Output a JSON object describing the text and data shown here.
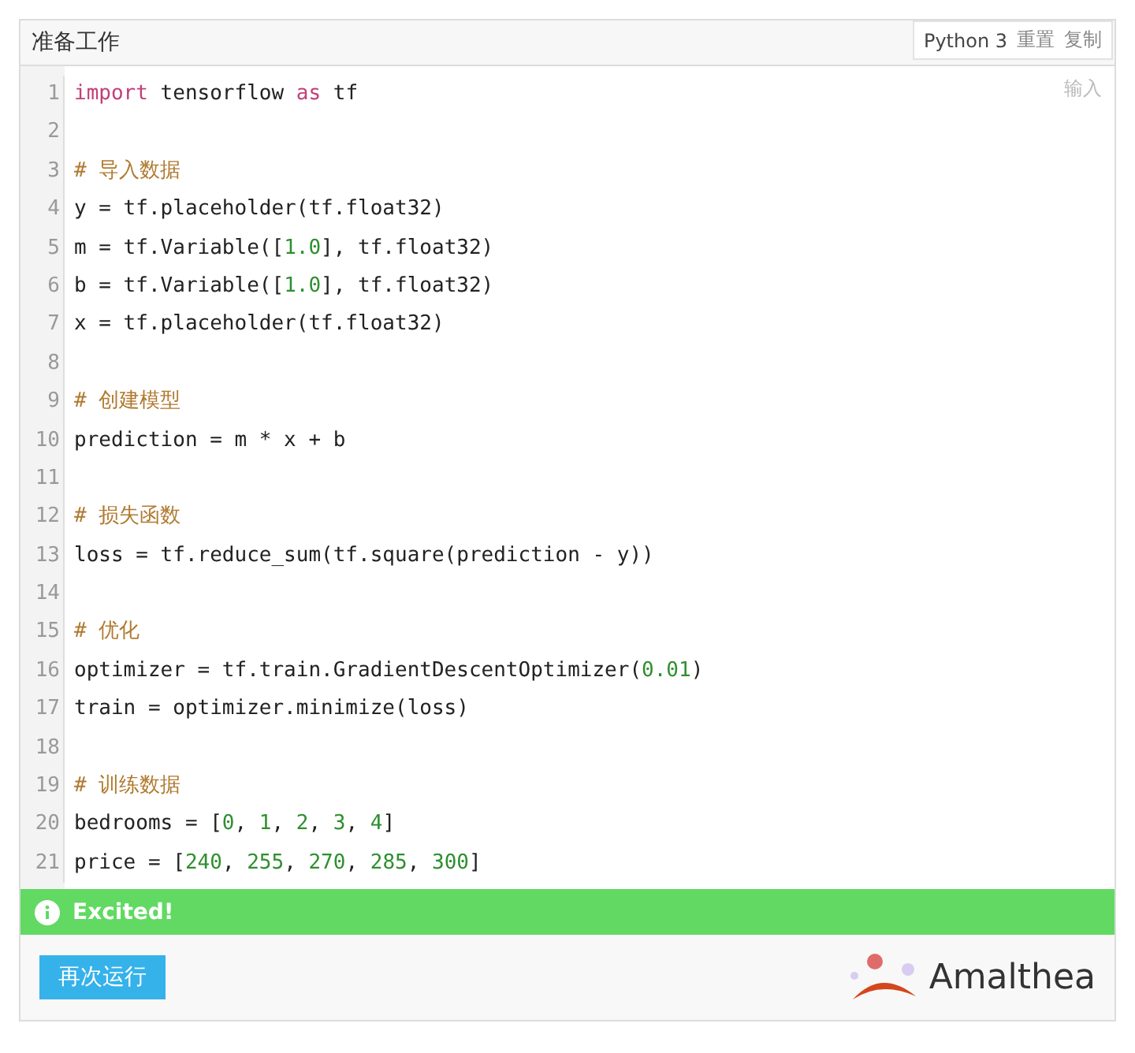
{
  "title": "准备工作",
  "toolbar": {
    "language": "Python 3",
    "actions": [
      "重置",
      "复制"
    ]
  },
  "editor": {
    "placeholder": "输入",
    "lines": [
      {
        "number": "1",
        "tokens": [
          {
            "kind": "keyword",
            "text": "import"
          },
          {
            "kind": "plain",
            "text": " tensorflow "
          },
          {
            "kind": "keyword",
            "text": "as"
          },
          {
            "kind": "plain",
            "text": " tf"
          }
        ]
      },
      {
        "number": "2"
      },
      {
        "number": "3",
        "tokens": [
          {
            "kind": "comment",
            "text": "# 导入数据"
          }
        ]
      },
      {
        "number": "4",
        "tokens": [
          {
            "kind": "plain",
            "text": "y = tf.placeholder(tf.float32)"
          }
        ]
      },
      {
        "number": "5",
        "tokens": [
          {
            "kind": "plain",
            "text": "m = tf.Variable(["
          },
          {
            "kind": "number",
            "text": "1.0"
          },
          {
            "kind": "plain",
            "text": "], tf.float32)"
          }
        ]
      },
      {
        "number": "6",
        "tokens": [
          {
            "kind": "plain",
            "text": "b = tf.Variable(["
          },
          {
            "kind": "number",
            "text": "1.0"
          },
          {
            "kind": "plain",
            "text": "], tf.float32)"
          }
        ]
      },
      {
        "number": "7",
        "tokens": [
          {
            "kind": "plain",
            "text": "x = tf.placeholder(tf.float32)"
          }
        ]
      },
      {
        "number": "8"
      },
      {
        "number": "9",
        "tokens": [
          {
            "kind": "comment",
            "text": "# 创建模型"
          }
        ]
      },
      {
        "number": "10",
        "tokens": [
          {
            "kind": "plain",
            "text": "prediction = m * x + b"
          }
        ]
      },
      {
        "number": "11"
      },
      {
        "number": "12",
        "tokens": [
          {
            "kind": "comment",
            "text": "# 损失函数"
          }
        ]
      },
      {
        "number": "13",
        "tokens": [
          {
            "kind": "plain",
            "text": "loss = tf.reduce_sum(tf.square(prediction - y))"
          }
        ]
      },
      {
        "number": "14"
      },
      {
        "number": "15",
        "tokens": [
          {
            "kind": "comment",
            "text": "# 优化"
          }
        ]
      },
      {
        "number": "16",
        "tokens": [
          {
            "kind": "plain",
            "text": "optimizer = tf.train.GradientDescentOptimizer("
          },
          {
            "kind": "number",
            "text": "0.01"
          },
          {
            "kind": "plain",
            "text": ")"
          }
        ]
      },
      {
        "number": "17",
        "tokens": [
          {
            "kind": "plain",
            "text": "train = optimizer.minimize(loss)"
          }
        ]
      },
      {
        "number": "18"
      },
      {
        "number": "19",
        "tokens": [
          {
            "kind": "comment",
            "text": "# 训练数据"
          }
        ]
      },
      {
        "number": "20",
        "tokens": [
          {
            "kind": "plain",
            "text": "bedrooms = ["
          },
          {
            "kind": "number",
            "text": "0"
          },
          {
            "kind": "plain",
            "text": ", "
          },
          {
            "kind": "number",
            "text": "1"
          },
          {
            "kind": "plain",
            "text": ", "
          },
          {
            "kind": "number",
            "text": "2"
          },
          {
            "kind": "plain",
            "text": ", "
          },
          {
            "kind": "number",
            "text": "3"
          },
          {
            "kind": "plain",
            "text": ", "
          },
          {
            "kind": "number",
            "text": "4"
          },
          {
            "kind": "plain",
            "text": "]"
          }
        ]
      },
      {
        "number": "21",
        "tokens": [
          {
            "kind": "plain",
            "text": "price = ["
          },
          {
            "kind": "number",
            "text": "240"
          },
          {
            "kind": "plain",
            "text": ", "
          },
          {
            "kind": "number",
            "text": "255"
          },
          {
            "kind": "plain",
            "text": ", "
          },
          {
            "kind": "number",
            "text": "270"
          },
          {
            "kind": "plain",
            "text": ", "
          },
          {
            "kind": "number",
            "text": "285"
          },
          {
            "kind": "plain",
            "text": ", "
          },
          {
            "kind": "number",
            "text": "300"
          },
          {
            "kind": "plain",
            "text": "]"
          }
        ]
      }
    ]
  },
  "status": {
    "kind": "success",
    "message": "Excited!"
  },
  "footer": {
    "button": "再次运行",
    "brand": "Amalthea"
  }
}
